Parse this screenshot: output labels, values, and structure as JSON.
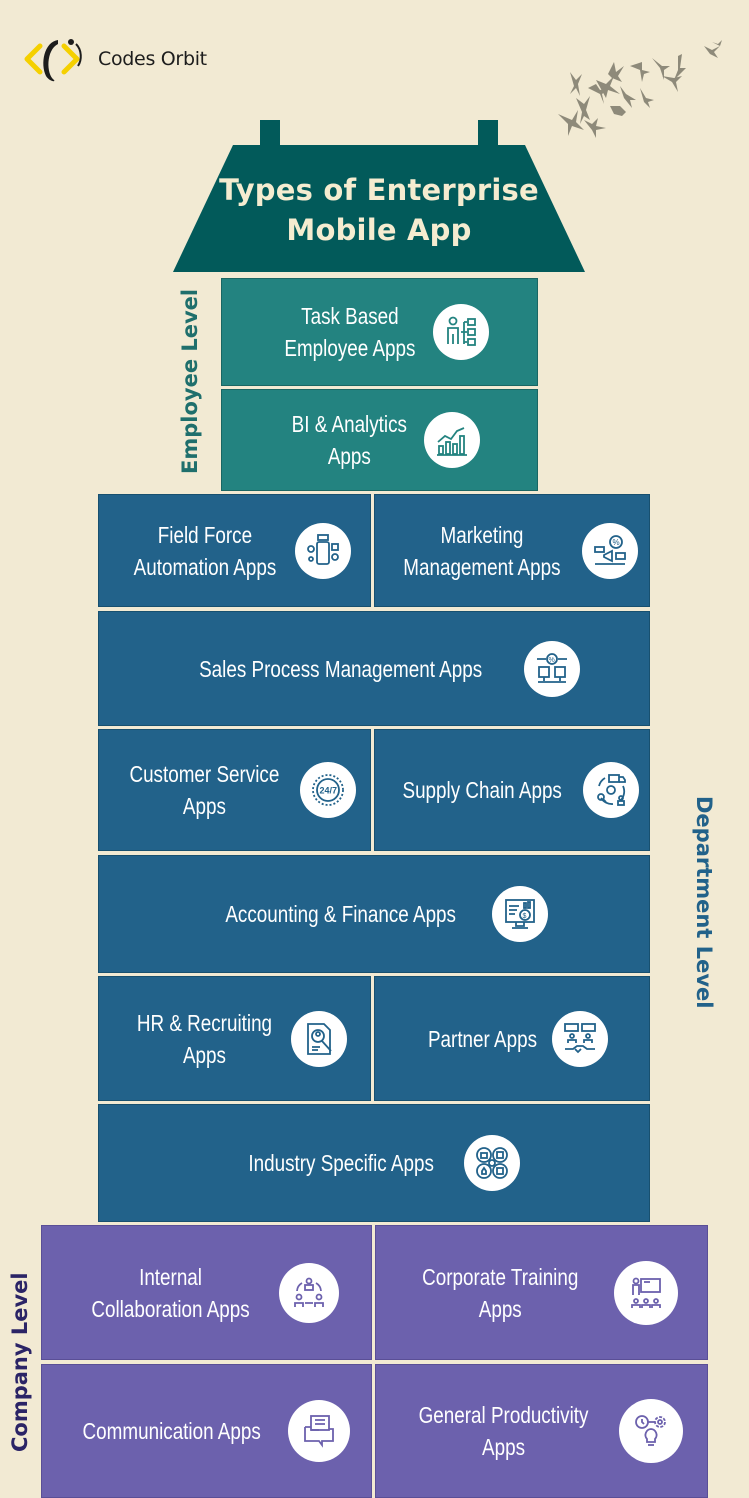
{
  "brand": {
    "name": "Codes Orbit",
    "logo_icon": "code-brackets-orbit-icon",
    "accent": "#f5d000"
  },
  "decoration": {
    "birds_icon": "flock-of-birds-icon",
    "birds_color": "#8e8a7a"
  },
  "title": {
    "line1": "Types of Enterprise",
    "line2": "Mobile App",
    "roof_color": "#025a5a"
  },
  "levels": {
    "employee": {
      "label": "Employee Level",
      "color": "#238380",
      "items": [
        {
          "label": "Task Based\nEmployee Apps",
          "icon": "task-checklist-person-icon"
        },
        {
          "label": "BI & Analytics\nApps",
          "icon": "analytics-chart-icon"
        }
      ]
    },
    "department": {
      "label": "Department Level",
      "color": "#22628a",
      "items": [
        {
          "label": "Field Force\nAutomation Apps",
          "icon": "mobile-field-force-icon"
        },
        {
          "label": "Marketing\nManagement Apps",
          "icon": "marketing-megaphone-icon"
        },
        {
          "label": "Sales Process Management Apps",
          "icon": "sales-process-percent-icon"
        },
        {
          "label": "Customer Service\nApps",
          "icon": "support-24-7-icon"
        },
        {
          "label": "Supply Chain Apps",
          "icon": "supply-chain-truck-icon"
        },
        {
          "label": "Accounting & Finance Apps",
          "icon": "finance-monitor-dollar-icon"
        },
        {
          "label": "HR & Recruiting\nApps",
          "icon": "recruiting-document-search-icon"
        },
        {
          "label": "Partner Apps",
          "icon": "partner-handshake-icon"
        },
        {
          "label": "Industry Specific Apps",
          "icon": "industry-gear-icon"
        }
      ]
    },
    "company": {
      "label": "Company Level",
      "color": "#6c61ad",
      "items": [
        {
          "label": "Internal\nCollaboration Apps",
          "icon": "collaboration-cycle-icon"
        },
        {
          "label": "Corporate Training\nApps",
          "icon": "training-presentation-icon"
        },
        {
          "label": "Communication Apps",
          "icon": "chat-bubbles-icon"
        },
        {
          "label": "General Productivity\nApps",
          "icon": "productivity-gear-bulb-icon"
        }
      ]
    }
  }
}
